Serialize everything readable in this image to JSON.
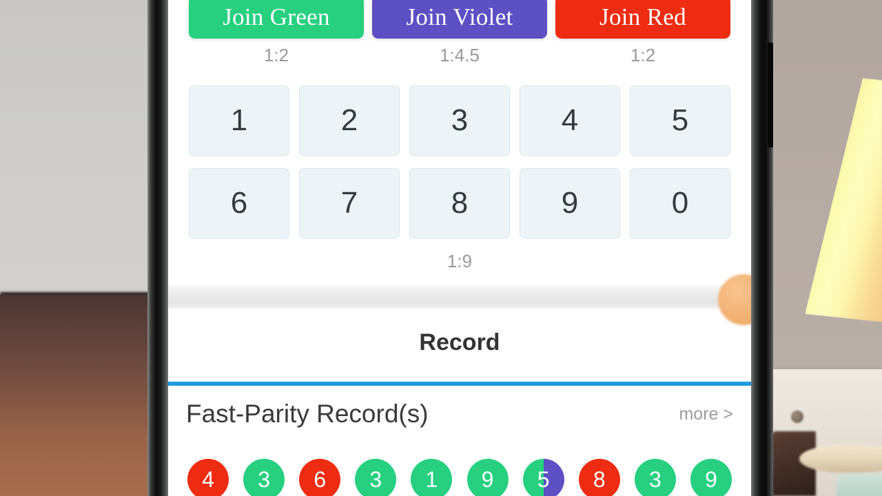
{
  "scene": {
    "background_description": "blurred room behind phone",
    "left_wall_color": "#cecdcb",
    "left_floor_color": "#9a6448",
    "right_wall_color": "#b6aba3",
    "lamp_color": "#fdfdc2"
  },
  "colors": {
    "green": "#26d07f",
    "violet": "#5d4fc4",
    "red": "#ed2c11",
    "accent_blue": "#1f9bdf",
    "number_cell_bg": "#edf4f8",
    "muted_text": "#9a9a9a"
  },
  "bet_buttons": [
    {
      "label": "Join Green",
      "odds": "1:2",
      "color_key": "green",
      "name": "join-green"
    },
    {
      "label": "Join Violet",
      "odds": "1:4.5",
      "color_key": "violet",
      "name": "join-violet"
    },
    {
      "label": "Join Red",
      "odds": "1:2",
      "color_key": "red",
      "name": "join-red"
    }
  ],
  "number_grid": {
    "row1": [
      "1",
      "2",
      "3",
      "4",
      "5"
    ],
    "row2": [
      "6",
      "7",
      "8",
      "9",
      "0"
    ],
    "odds": "1:9"
  },
  "float_bubble": {
    "label": "..."
  },
  "record": {
    "heading": "Record",
    "section_title": "Fast-Parity Record(s)",
    "more_label": "more >"
  },
  "results": [
    {
      "value": "4",
      "style": "red"
    },
    {
      "value": "3",
      "style": "green"
    },
    {
      "value": "6",
      "style": "red"
    },
    {
      "value": "3",
      "style": "green"
    },
    {
      "value": "1",
      "style": "green"
    },
    {
      "value": "9",
      "style": "green"
    },
    {
      "value": "5",
      "style": "green-violet"
    },
    {
      "value": "8",
      "style": "red"
    },
    {
      "value": "3",
      "style": "green"
    },
    {
      "value": "9",
      "style": "green"
    }
  ]
}
